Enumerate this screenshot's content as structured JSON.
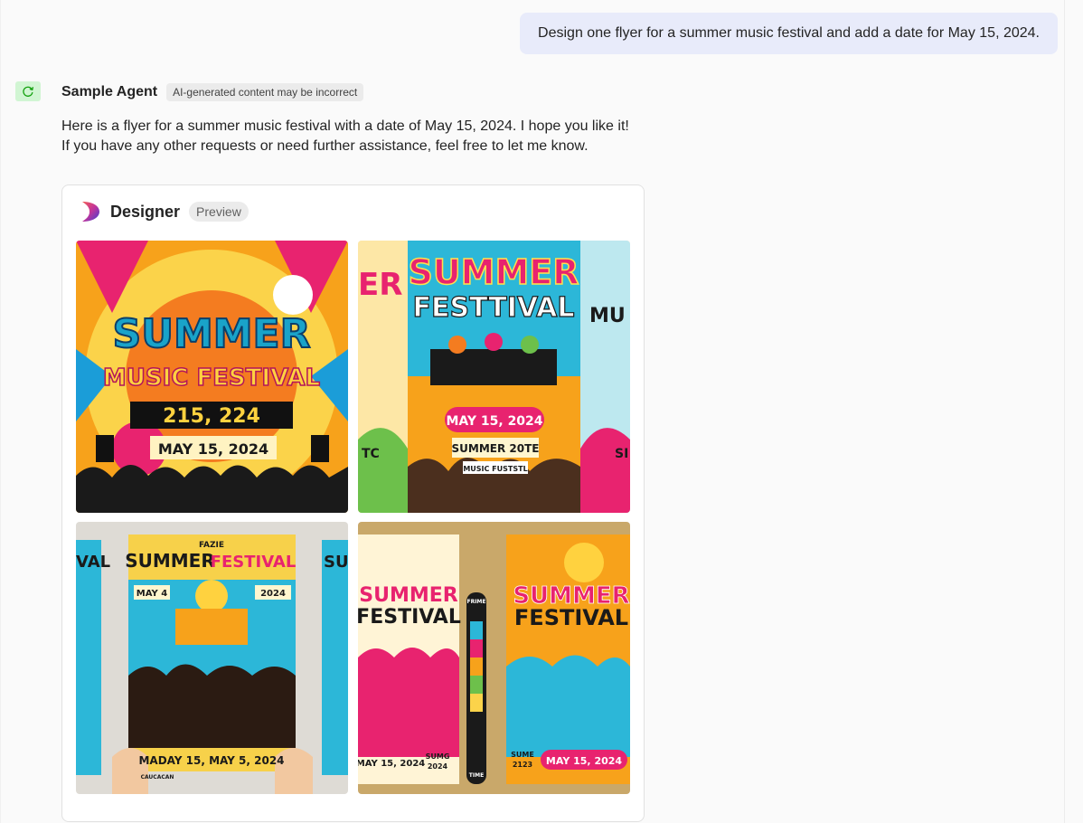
{
  "user_message": "Design one flyer for a summer music festival and add a date for May 15, 2024.",
  "agent": {
    "name": "Sample Agent",
    "disclaimer": "AI-generated content may be incorrect",
    "avatar_icon": "refresh-icon",
    "message": "Here is a flyer for a summer music festival with a date of May 15, 2024. I hope you like it! If you have any other requests or need further assistance, feel free to let me know."
  },
  "designer_card": {
    "title": "Designer",
    "badge": "Preview",
    "logo_icon": "designer-logo-icon",
    "images": [
      {
        "lines": [
          "SUMMER",
          "MUSIC FESTIVAL",
          "215, 224",
          "MAY 15, 2024"
        ]
      },
      {
        "lines": [
          "SUMMER",
          "FESTTIVAL",
          "MAY 15, 2024",
          "SUMMER 20TE",
          "MUSIC FUSTSTL",
          "ER",
          "MU",
          "TC",
          "SI"
        ]
      },
      {
        "lines": [
          "FAZIE",
          "SUMMER",
          "FESTIVAL",
          "MAY 4",
          "2024",
          "MADAY 15, MAY 5, 2024",
          "CAUCACAN",
          "VAL",
          "SU"
        ]
      },
      {
        "lines": [
          "SUMMER",
          "FESTIVAL",
          "FRIME",
          "TIME",
          "MAY 15, 2024",
          "SUMG",
          "2024",
          "SUMMER",
          "FESTIVAL",
          "SUME",
          "2123",
          "MAY 15, 2024"
        ]
      }
    ]
  },
  "colors": {
    "user_bubble": "#e8ebfa",
    "avatar_bg": "#d1f5d3",
    "avatar_icon": "#13a10e",
    "badge_bg": "#ebebeb"
  }
}
